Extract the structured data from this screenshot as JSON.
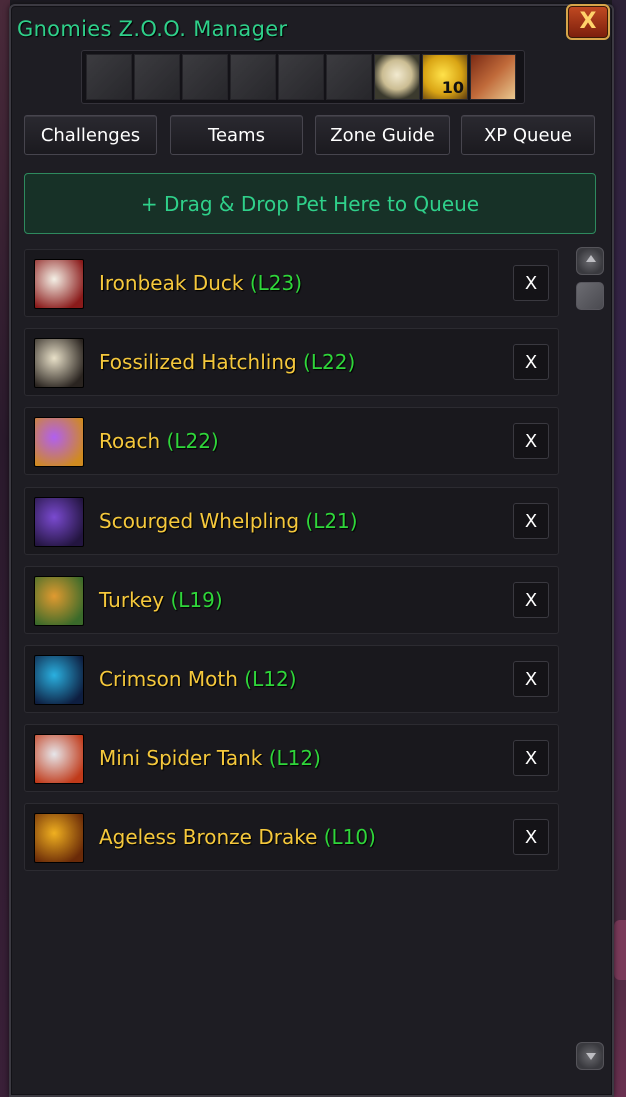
{
  "window": {
    "title": "Gnomies Z.O.O. Manager",
    "close_label": "X"
  },
  "icon_strip": [
    {
      "name": "feather-icon",
      "state": "dim"
    },
    {
      "name": "claw-icon",
      "state": "dim"
    },
    {
      "name": "sausage-icon",
      "state": "dim"
    },
    {
      "name": "stone-tile-icon",
      "state": "dim"
    },
    {
      "name": "stone-tile-icon",
      "state": "dim"
    },
    {
      "name": "stone-tile-icon",
      "state": "dim"
    },
    {
      "name": "pith-helmet-icon",
      "state": "active"
    },
    {
      "name": "golden-egg-icon",
      "state": "active",
      "count": "10"
    },
    {
      "name": "book-icon",
      "state": "active"
    }
  ],
  "tabs": [
    {
      "label": "Challenges"
    },
    {
      "label": "Teams"
    },
    {
      "label": "Zone Guide"
    },
    {
      "label": "XP Queue"
    }
  ],
  "drop_zone": {
    "label": "+ Drag & Drop Pet Here to Queue"
  },
  "queue": [
    {
      "name": "Ironbeak Duck",
      "level": "(L23)",
      "icon": "duck-portrait-icon",
      "colors": [
        "#f4f0e6",
        "#8a1a1a"
      ]
    },
    {
      "name": "Fossilized Hatchling",
      "level": "(L22)",
      "icon": "skeleton-portrait-icon",
      "colors": [
        "#e8e0c8",
        "#2a2420"
      ]
    },
    {
      "name": "Roach",
      "level": "(L22)",
      "icon": "roach-portrait-icon",
      "colors": [
        "#b060f0",
        "#d08a20"
      ]
    },
    {
      "name": "Scourged Whelpling",
      "level": "(L21)",
      "icon": "whelp-portrait-icon",
      "colors": [
        "#7a4ad0",
        "#231540"
      ]
    },
    {
      "name": "Turkey",
      "level": "(L19)",
      "icon": "turkey-portrait-icon",
      "colors": [
        "#e09a30",
        "#3a6a2a"
      ]
    },
    {
      "name": "Crimson Moth",
      "level": "(L12)",
      "icon": "moth-portrait-icon",
      "colors": [
        "#2ab0e0",
        "#0e1e40"
      ]
    },
    {
      "name": "Mini Spider Tank",
      "level": "(L12)",
      "icon": "spider-tank-portrait-icon",
      "colors": [
        "#e6e6ea",
        "#c03a1a"
      ]
    },
    {
      "name": "Ageless Bronze Drake",
      "level": "(L10)",
      "icon": "drake-portrait-icon",
      "colors": [
        "#f0b020",
        "#6a2a08"
      ]
    }
  ],
  "remove_label": "X",
  "colors": {
    "title": "#2fd08a",
    "pet_name": "#f5c83c",
    "pet_level": "#2fd63a",
    "drop_zone_bg": "#173127"
  }
}
